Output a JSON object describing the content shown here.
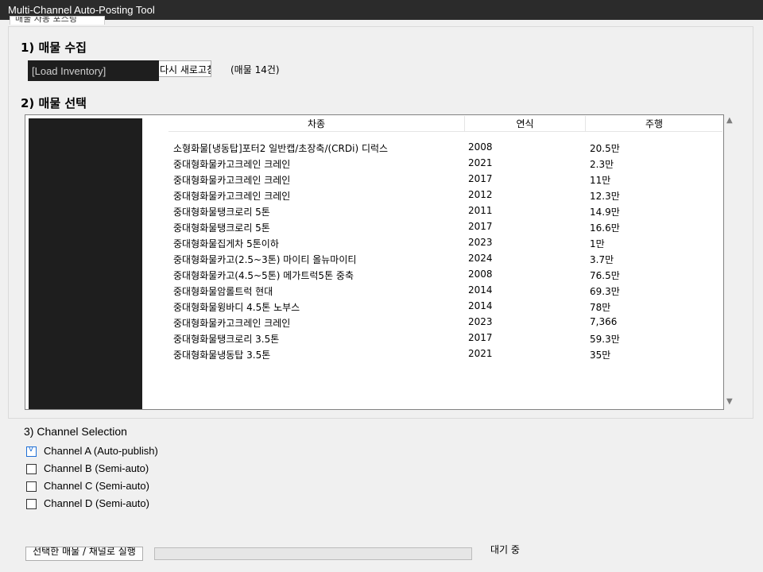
{
  "window": {
    "title": "Multi-Channel Auto-Posting Tool"
  },
  "tab": {
    "label": "매물 자동 포스팅"
  },
  "section1": {
    "title": "1) 매물 수집",
    "load_button": "[Load Inventory]",
    "refresh_button": "다시 새로고침",
    "count_label": "(매물 14건)"
  },
  "section2": {
    "title": "2) 매물 선택",
    "columns": [
      "차종",
      "연식",
      "주행"
    ],
    "rows": [
      {
        "name": "소형화물[냉동탑]포터2 일반캡/초장축/(CRDi) 디럭스",
        "year": "2008",
        "mileage": "20.5만"
      },
      {
        "name": "중대형화물카고크레인 크레인",
        "year": "2021",
        "mileage": "2.3만"
      },
      {
        "name": "중대형화물카고크레인 크레인",
        "year": "2017",
        "mileage": "11만"
      },
      {
        "name": "중대형화물카고크레인 크레인",
        "year": "2012",
        "mileage": "12.3만"
      },
      {
        "name": "중대형화물탱크로리 5톤",
        "year": "2011",
        "mileage": "14.9만"
      },
      {
        "name": "중대형화물탱크로리 5톤",
        "year": "2017",
        "mileage": "16.6만"
      },
      {
        "name": "중대형화물집게차 5톤이하",
        "year": "2023",
        "mileage": "1만"
      },
      {
        "name": "중대형화물카고(2.5~3톤) 마이티 올뉴마이티",
        "year": "2024",
        "mileage": "3.7만"
      },
      {
        "name": "중대형화물카고(4.5~5톤) 메가트럭5톤 중축",
        "year": "2008",
        "mileage": "76.5만"
      },
      {
        "name": "중대형화물암롤트럭 현대",
        "year": "2014",
        "mileage": "69.3만"
      },
      {
        "name": "중대형화물윙바디 4.5톤 노부스",
        "year": "2014",
        "mileage": "78만"
      },
      {
        "name": "중대형화물카고크레인 크레인",
        "year": "2023",
        "mileage": "7,366"
      },
      {
        "name": "중대형화물탱크로리 3.5톤",
        "year": "2017",
        "mileage": "59.3만"
      },
      {
        "name": "중대형화물냉동탑 3.5톤",
        "year": "2021",
        "mileage": "35만"
      }
    ]
  },
  "section3": {
    "title": "3)  Channel Selection",
    "channels": [
      {
        "label": "Channel A  (Auto-publish)",
        "checked": true
      },
      {
        "label": "Channel B  (Semi-auto)",
        "checked": false
      },
      {
        "label": "Channel C  (Semi-auto)",
        "checked": false
      },
      {
        "label": "Channel D  (Semi-auto)",
        "checked": false
      }
    ]
  },
  "footer": {
    "run_button": "선택한 매물 / 채널로 실행",
    "status": "대기 중"
  }
}
